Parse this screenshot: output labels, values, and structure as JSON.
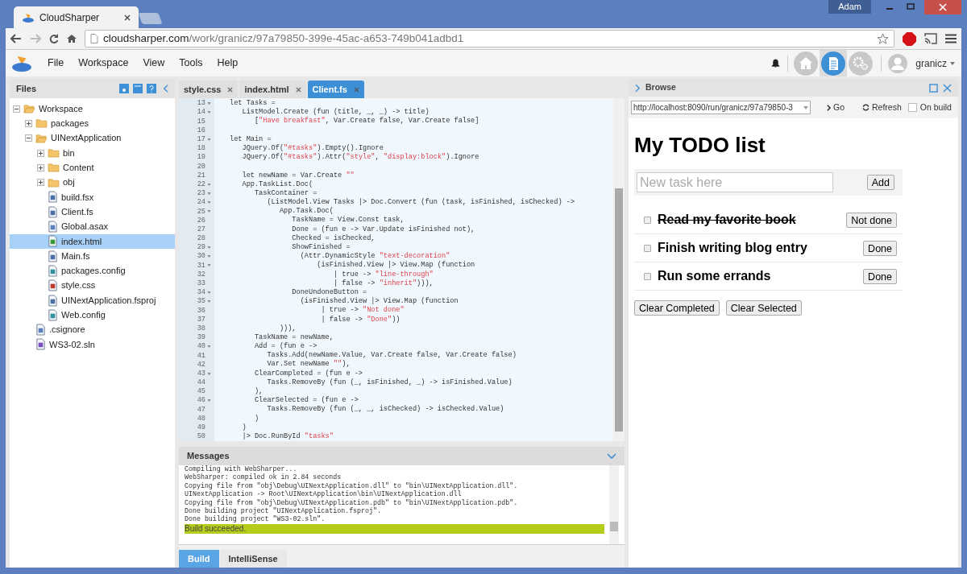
{
  "browser": {
    "tabs": [
      {
        "title": "CloudSharper",
        "selected": true
      }
    ],
    "user": "Adam",
    "url_host": "cloudsharper.com",
    "url_path": "/work/granicz/97a79850-399e-45ac-a653-749b041adbd1"
  },
  "menu": [
    "File",
    "Workspace",
    "View",
    "Tools",
    "Help"
  ],
  "toolbar": {
    "views": [
      {
        "kind": "home",
        "selected": false
      },
      {
        "kind": "document",
        "selected": true
      },
      {
        "kind": "settings",
        "selected": false
      }
    ],
    "user": "granicz"
  },
  "files": {
    "title": "Files",
    "tree": [
      {
        "name": "Workspace",
        "kind": "folder",
        "expanded": true,
        "selected": false,
        "children": [
          {
            "name": "packages",
            "kind": "folder",
            "expanded": false,
            "selected": false
          },
          {
            "name": "UINextApplication",
            "kind": "folder",
            "expanded": true,
            "selected": false,
            "children": [
              {
                "name": "bin",
                "kind": "folder",
                "expanded": false,
                "selected": false
              },
              {
                "name": "Content",
                "kind": "folder",
                "expanded": false,
                "selected": false
              },
              {
                "name": "obj",
                "kind": "folder",
                "expanded": false,
                "selected": false
              },
              {
                "name": "build.fsx",
                "kind": "fs",
                "selected": false
              },
              {
                "name": "Client.fs",
                "kind": "fs",
                "selected": false
              },
              {
                "name": "Global.asax",
                "kind": "doc",
                "selected": false
              },
              {
                "name": "index.html",
                "kind": "html",
                "selected": true
              },
              {
                "name": "Main.fs",
                "kind": "fs",
                "selected": false
              },
              {
                "name": "packages.config",
                "kind": "config",
                "selected": false
              },
              {
                "name": "style.css",
                "kind": "css",
                "selected": false
              },
              {
                "name": "UINextApplication.fsproj",
                "kind": "fs",
                "selected": false
              },
              {
                "name": "Web.config",
                "kind": "config",
                "selected": false
              }
            ]
          },
          {
            "name": ".csignore",
            "kind": "doc",
            "selected": false
          },
          {
            "name": "WS3-02.sln",
            "kind": "sln",
            "selected": false
          }
        ]
      }
    ]
  },
  "editor": {
    "tabs": [
      {
        "label": "style.css",
        "selected": false
      },
      {
        "label": "index.html",
        "selected": false
      },
      {
        "label": "Client.fs",
        "selected": true
      }
    ],
    "lines": [
      {
        "num": "13",
        "fold": true,
        "text": "let Tasks ="
      },
      {
        "num": "14",
        "fold": true,
        "text": "   ListModel.Create (fun (title, _, _) -> title)"
      },
      {
        "num": "15",
        "fold": false,
        "text": "      [\"Have breakfast\", Var.Create false, Var.Create false]"
      },
      {
        "num": "16",
        "fold": false
      },
      {
        "num": "17",
        "fold": true,
        "text": "let Main ="
      },
      {
        "num": "18",
        "fold": false,
        "text": "   JQuery.Of(\"#tasks\").Empty().Ignore"
      },
      {
        "num": "19",
        "fold": false,
        "text": "   JQuery.Of(\"#tasks\").Attr(\"style\", \"display:block\").Ignore"
      },
      {
        "num": "20",
        "fold": false
      },
      {
        "num": "21",
        "fold": false,
        "text": "   let newName = Var.Create \"\""
      },
      {
        "num": "22",
        "fold": true,
        "text": "   App.TaskList.Doc("
      },
      {
        "num": "23",
        "fold": true,
        "text": "      TaskContainer ="
      },
      {
        "num": "24",
        "fold": true,
        "text": "         (ListModel.View Tasks |> Doc.Convert (fun (task, isFinished, isChecked) ->"
      },
      {
        "num": "25",
        "fold": true,
        "text": "            App.Task.Doc("
      },
      {
        "num": "26",
        "fold": false,
        "text": "               TaskName = View.Const task,"
      },
      {
        "num": "27",
        "fold": false,
        "text": "               Done = (fun e -> Var.Update isFinished not),"
      },
      {
        "num": "28",
        "fold": false,
        "text": "               Checked = isChecked,"
      },
      {
        "num": "29",
        "fold": true,
        "text": "               ShowFinished ="
      },
      {
        "num": "30",
        "fold": true,
        "text": "                 (Attr.DynamicStyle \"text-decoration\""
      },
      {
        "num": "31",
        "fold": true,
        "text": "                     (isFinished.View |> View.Map (function"
      },
      {
        "num": "32",
        "fold": false,
        "text": "                         | true -> \"line-through\""
      },
      {
        "num": "33",
        "fold": false,
        "text": "                         | false -> \"inherit\"))),"
      },
      {
        "num": "34",
        "fold": true,
        "text": "               DoneUndoneButton ="
      },
      {
        "num": "35",
        "fold": true,
        "text": "                 (isFinished.View |> View.Map (function"
      },
      {
        "num": "36",
        "fold": false,
        "text": "                      | true -> \"Not done\""
      },
      {
        "num": "37",
        "fold": false,
        "text": "                      | false -> \"Done\"))"
      },
      {
        "num": "38",
        "fold": false,
        "text": "            ))),"
      },
      {
        "num": "39",
        "fold": false,
        "text": "      TaskName = newName,"
      },
      {
        "num": "40",
        "fold": true,
        "text": "      Add = (fun e ->"
      },
      {
        "num": "41",
        "fold": false,
        "text": "         Tasks.Add(newName.Value, Var.Create false, Var.Create false)"
      },
      {
        "num": "42",
        "fold": false,
        "text": "         Var.Set newName \"\"),"
      },
      {
        "num": "43",
        "fold": true,
        "text": "      ClearCompleted = (fun e ->"
      },
      {
        "num": "44",
        "fold": false,
        "text": "         Tasks.RemoveBy (fun (_, isFinished, _) -> isFinished.Value)"
      },
      {
        "num": "45",
        "fold": false,
        "text": "      ),"
      },
      {
        "num": "46",
        "fold": true,
        "text": "      ClearSelected = (fun e ->"
      },
      {
        "num": "47",
        "fold": false,
        "text": "         Tasks.RemoveBy (fun (_, _, isChecked) -> isChecked.Value)"
      },
      {
        "num": "48",
        "fold": false,
        "text": "      )"
      },
      {
        "num": "49",
        "fold": false,
        "text": "   )"
      },
      {
        "num": "50",
        "fold": false,
        "text": "   |> Doc.RunById \"tasks\""
      }
    ]
  },
  "messages": {
    "title": "Messages",
    "lines": [
      {
        "text": "Compiling with WebSharper...",
        "highlighted": false
      },
      {
        "text": "WebSharper: compiled ok in 2.84 seconds",
        "highlighted": false
      },
      {
        "text": "Copying file from \"obj\\Debug\\UINextApplication.dll\" to \"bin\\UINextApplication.dll\".",
        "highlighted": false
      },
      {
        "text": "UINextApplication -> Root\\UINextApplication\\bin\\UINextApplication.dll",
        "highlighted": false
      },
      {
        "text": "Copying file from \"obj\\Debug\\UINextApplication.pdb\" to \"bin\\UINextApplication.pdb\".",
        "highlighted": false
      },
      {
        "text": "Done building project \"UINextApplication.fsproj\".",
        "highlighted": false
      },
      {
        "text": "Done building project \"WS3-02.sln\".",
        "highlighted": false
      },
      {
        "text": "Build succeeded.",
        "highlighted": true
      }
    ],
    "tabs": [
      {
        "label": "Build",
        "selected": true
      },
      {
        "label": "IntelliSense",
        "selected": false
      }
    ]
  },
  "browse": {
    "title": "Browse",
    "url": "http://localhost:8090/run/granicz/97a79850-3",
    "go": "Go",
    "refresh": "Refresh",
    "on_build": {
      "label": "On build",
      "checked": false
    },
    "page": {
      "heading": "My TODO list",
      "placeholder": "New task here",
      "add": "Add",
      "tasks": [
        {
          "name": "Read my favorite book",
          "checked": false,
          "finished": true,
          "button": "Not done"
        },
        {
          "name": "Finish writing blog entry",
          "checked": false,
          "finished": false,
          "button": "Done"
        },
        {
          "name": "Run some errands",
          "checked": false,
          "finished": false,
          "button": "Done"
        }
      ],
      "actions": [
        "Clear Completed",
        "Clear Selected"
      ]
    }
  }
}
